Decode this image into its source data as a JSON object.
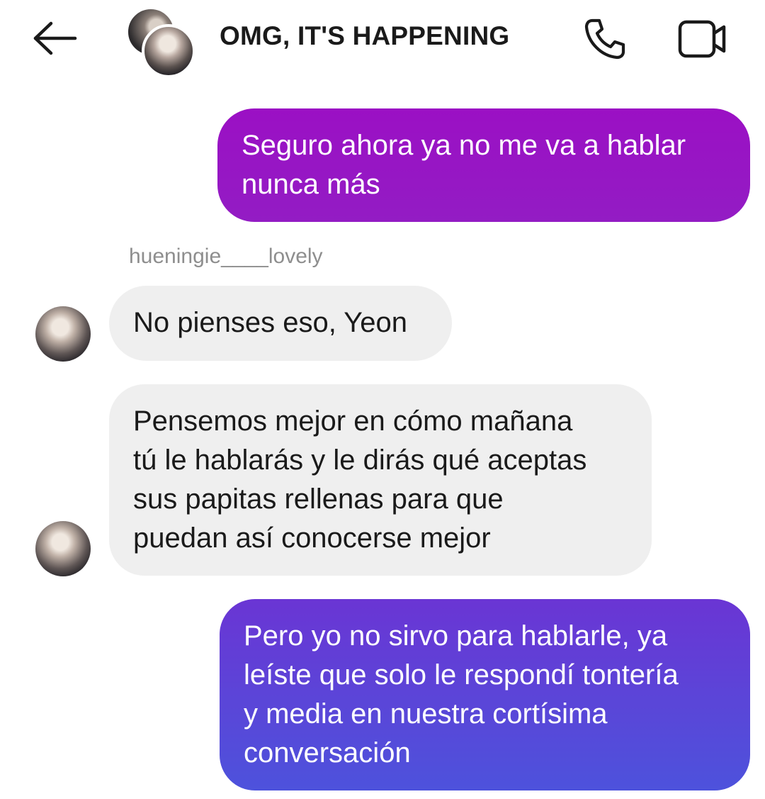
{
  "header": {
    "title": "OMG, IT'S HAPPENING",
    "back_icon": "arrow-left-icon",
    "call_icon": "phone-icon",
    "video_icon": "video-camera-icon"
  },
  "messages": [
    {
      "direction": "outgoing",
      "text": "Seguro ahora ya no me va a hablar\nnunca más"
    },
    {
      "direction": "incoming",
      "sender": "hueningie____lovely",
      "text": "No pienses eso, Yeon"
    },
    {
      "direction": "incoming",
      "text": "Pensemos mejor en cómo mañana\ntú le hablarás y le dirás qué aceptas\nsus papitas rellenas para que\npuedan así conocerse mejor"
    },
    {
      "direction": "outgoing",
      "text": "Pero yo no sirvo para hablarle, ya\nleíste que solo le respondí tontería\ny media en nuestra cortísima\nconversación"
    }
  ],
  "colors": {
    "outgoing_bubble_1": "#9b10c4",
    "outgoing_bubble_2_top": "#6a35d4",
    "outgoing_bubble_2_bottom": "#4d52dc",
    "incoming_bubble": "#efefef",
    "sender_name": "#8e8e8e"
  }
}
